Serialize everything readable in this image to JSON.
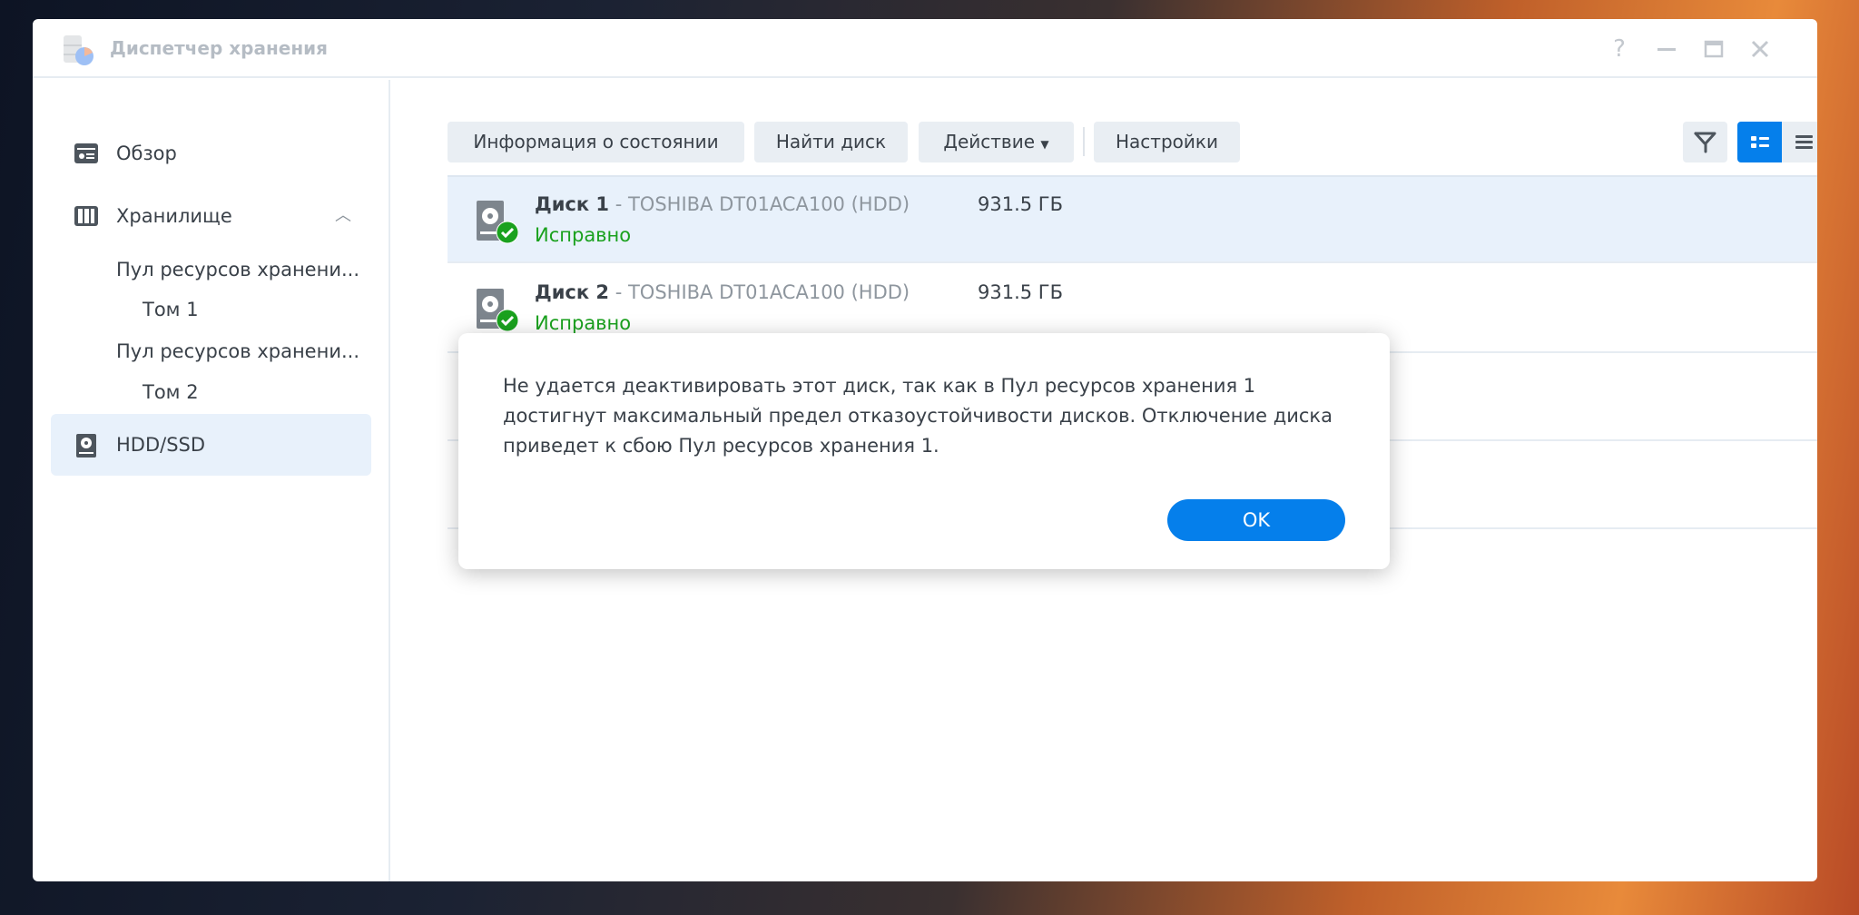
{
  "window": {
    "title": "Диспетчер хранения",
    "controls": [
      "help-icon",
      "minimize-icon",
      "maximize-icon",
      "close-icon"
    ]
  },
  "sidebar": {
    "items": [
      {
        "label": "Обзор",
        "icon": "overview-icon"
      },
      {
        "label": "Хранилище",
        "icon": "storage-icon",
        "expanded": true
      },
      {
        "label": "Пул ресурсов хранени..."
      },
      {
        "label": "Том 1"
      },
      {
        "label": "Пул ресурсов хранени..."
      },
      {
        "label": "Том 2"
      },
      {
        "label": "HDD/SSD",
        "icon": "hdd-icon",
        "selected": true
      }
    ]
  },
  "toolbar": {
    "health_info": "Информация о состоянии",
    "find_disk": "Найти диск",
    "action": "Действие",
    "settings": "Настройки"
  },
  "disks": [
    {
      "name": "Диск 1",
      "model": " - TOSHIBA DT01ACA100 (HDD)",
      "size": "931.5 ГБ",
      "status": "Исправно"
    },
    {
      "name": "Диск 2",
      "model": " - TOSHIBA DT01ACA100 (HDD)",
      "size": "931.5 ГБ",
      "status": "Исправно"
    }
  ],
  "dialog": {
    "message": "Не удается деактивировать этот диск, так как в Пул ресурсов хранения 1 достигнут максимальный предел отказоустойчивости дисков. Отключение диска приведет к сбою Пул ресурсов хранения 1.",
    "ok": "OK"
  },
  "colors": {
    "accent": "#057feb",
    "healthy": "#1aa11e",
    "selected_bg": "#e8f1fb"
  }
}
